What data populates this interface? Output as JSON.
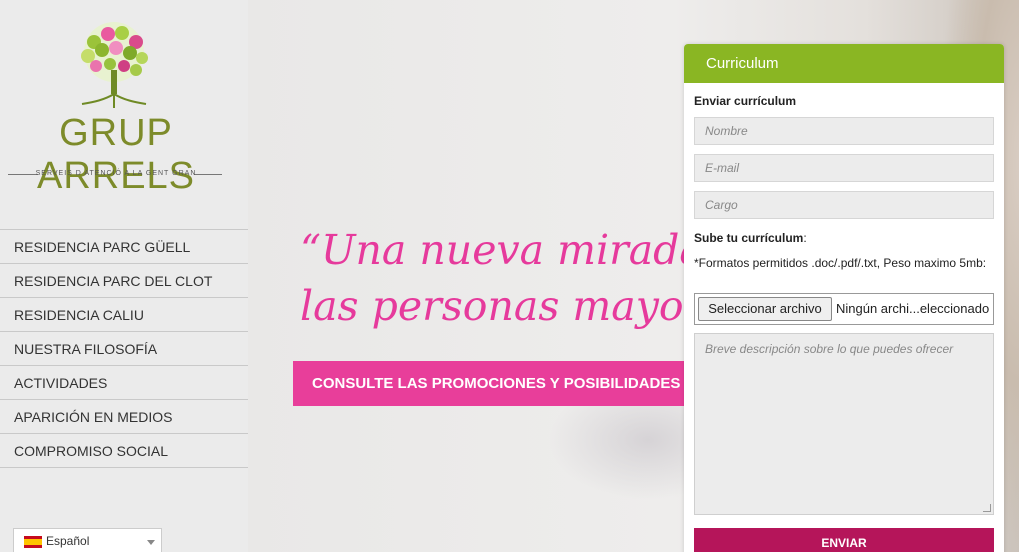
{
  "logo": {
    "brand": "GRUP ARRELS",
    "tagline": "SERVEIS D ATENCIÓ A LA GENT GRAN",
    "icon": "tree-icon"
  },
  "nav": {
    "items": [
      {
        "label": "RESIDENCIA PARC GÜELL"
      },
      {
        "label": "RESIDENCIA PARC DEL CLOT"
      },
      {
        "label": "RESIDENCIA CALIU"
      },
      {
        "label": "NUESTRA FILOSOFÍA"
      },
      {
        "label": "ACTIVIDADES"
      },
      {
        "label": "APARICIÓN EN MEDIOS"
      },
      {
        "label": "COMPROMISO SOCIAL"
      }
    ]
  },
  "language": {
    "selected": "Español",
    "icon": "spain-flag-icon"
  },
  "hero": {
    "quote": "“Una nueva mirada\nlas personas mayor",
    "promo_label": "CONSULTE LAS PROMOCIONES Y POSIBILIDADES"
  },
  "form": {
    "header": "Curriculum",
    "title": "Enviar currículum",
    "name_placeholder": "Nombre",
    "email_placeholder": "E-mail",
    "cargo_placeholder": "Cargo",
    "upload_label": "Sube tu currículum",
    "upload_colon": ":",
    "formats": "*Formatos permitidos .doc/.pdf/.txt, Peso maximo 5mb:",
    "file_button": "Seleccionar archivo",
    "file_status": "Ningún archi...eleccionado",
    "description_placeholder": "Breve descripción sobre lo que puedes ofrecer",
    "submit_label": "ENVIAR"
  },
  "colors": {
    "brand_green": "#8ab623",
    "pink": "#e83e9a",
    "submit": "#b5155a",
    "logo_green": "#7d8b2a"
  }
}
